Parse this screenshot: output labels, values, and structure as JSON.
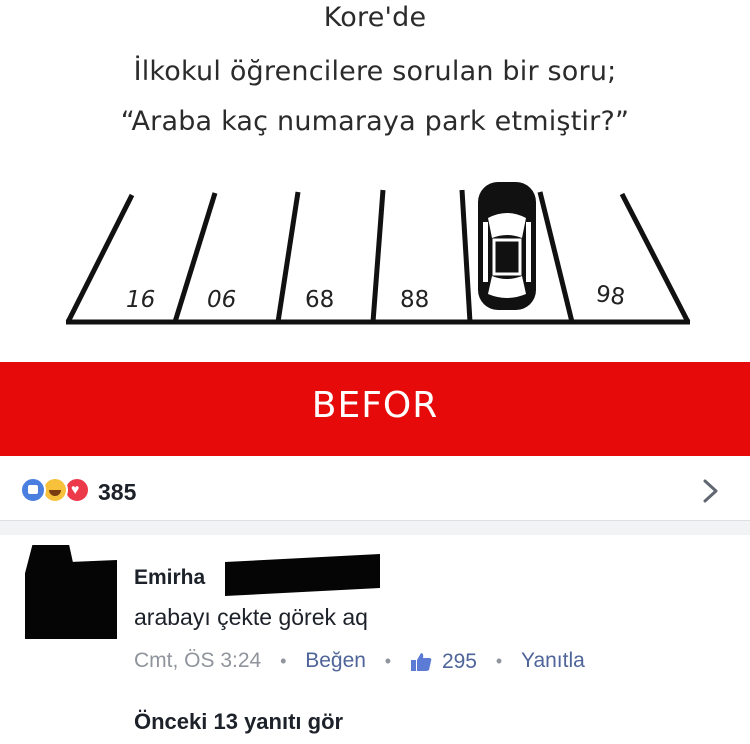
{
  "puzzle": {
    "title_lines": [
      "Kore'de",
      "İlkokul öğrencilere sorulan bir soru;",
      "“Araba kaç numaraya park etmiştir?”"
    ],
    "spot_numbers": [
      "16",
      "06",
      "68",
      "88",
      "98"
    ]
  },
  "banner": {
    "label": "BEFOR",
    "color": "#e60a0a"
  },
  "post": {
    "reactions": {
      "icons": [
        "like-icon",
        "haha-icon",
        "love-icon"
      ],
      "count": "385"
    },
    "comment": {
      "author": "Emirha",
      "text": "arabayı çekte görek aq",
      "time": "Cmt, ÖS 3:24",
      "like_label": "Beğen",
      "like_count": "295",
      "reply_label": "Yanıtla"
    },
    "more_replies": "Önceki 13 yanıtı gör"
  }
}
